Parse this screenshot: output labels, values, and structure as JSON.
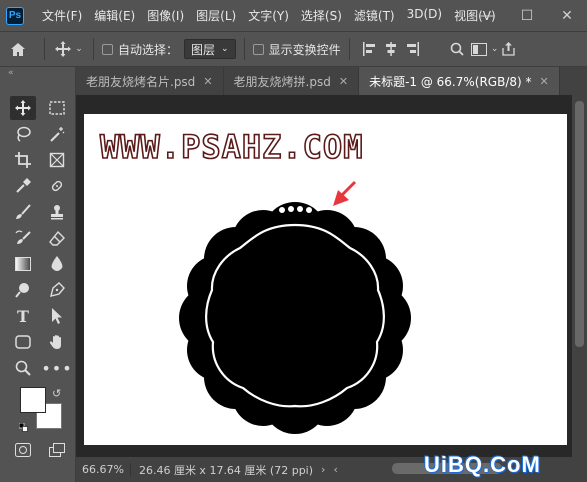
{
  "app": {
    "logo": "Ps"
  },
  "menu": [
    "文件(F)",
    "编辑(E)",
    "图像(I)",
    "图层(L)",
    "文字(Y)",
    "选择(S)",
    "滤镜(T)",
    "3D(D)",
    "视图(V)"
  ],
  "options": {
    "auto_select_label": "自动选择：",
    "auto_select_value": "图层",
    "show_transform_label": "显示变换控件",
    "auto_select_checked": false,
    "show_transform_checked": false
  },
  "tabs": [
    {
      "label": "老朋友烧烤名片.psd",
      "active": false
    },
    {
      "label": "老朋友烧烤拼.psd",
      "active": false
    },
    {
      "label": "未标题-1 @ 66.7%(RGB/8) *",
      "active": true
    }
  ],
  "canvas": {
    "headline": "WWW.PSAHZ.COM",
    "headline_fill": "#ffffff",
    "headline_outline": "#5a1a1a",
    "shape_color": "#000000",
    "arrow_color": "#e8373c"
  },
  "status": {
    "zoom": "66.67%",
    "dimensions": "26.46 厘米 x 17.64 厘米 (72 ppi)"
  },
  "watermark": "UiBQ.CoM",
  "colors": {
    "foreground": "#ffffff",
    "background": "#ffffff"
  }
}
